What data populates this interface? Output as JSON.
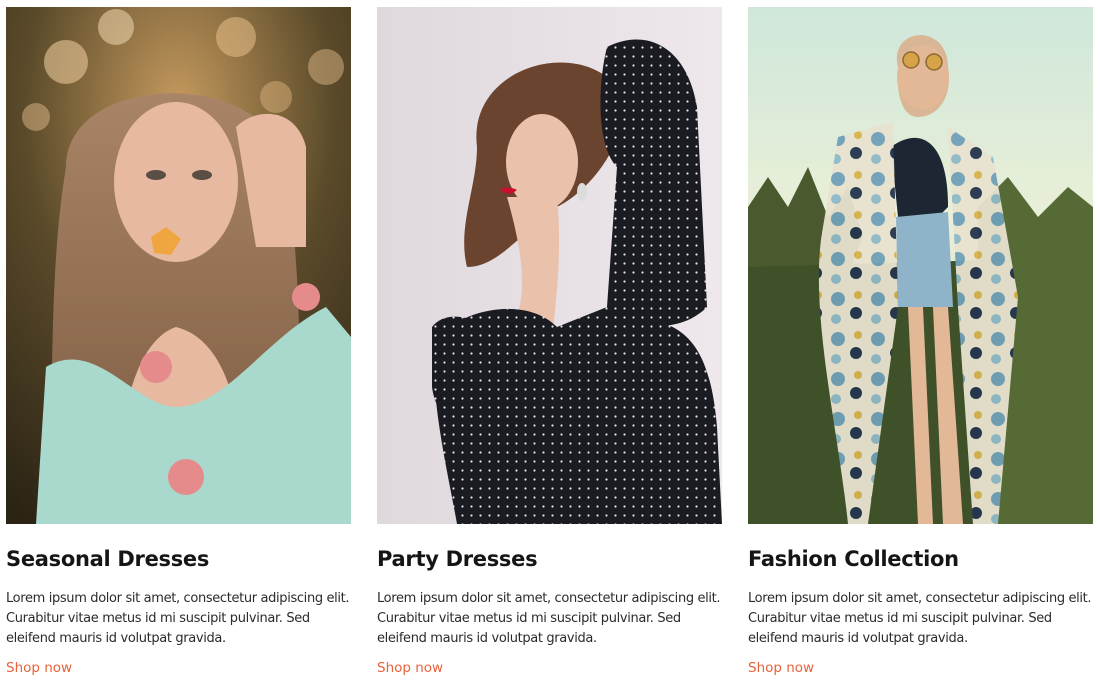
{
  "cards": [
    {
      "title": "Seasonal Dresses",
      "description_lines": [
        "Lorem ipsum dolor sit amet, consectetur adipiscing elit.",
        "Curabitur vitae metus id mi suscipit pulvinar. Sed",
        "eleifend mauris id volutpat gravida."
      ],
      "link": "Shop now",
      "image": "woman-long-hair-flower-photo"
    },
    {
      "title": "Party Dresses",
      "description_lines": [
        "Lorem ipsum dolor sit amet, consectetur adipiscing elit.",
        "Curabitur vitae metus id mi suscipit pulvinar. Sed",
        "eleifend mauris id volutpat gravida."
      ],
      "link": "Shop now",
      "image": "woman-polka-dot-dress-photo"
    },
    {
      "title": "Fashion Collection",
      "description_lines": [
        "Lorem ipsum dolor sit amet, consectetur adipiscing elit.",
        "Curabitur vitae metus id mi suscipit pulvinar. Sed",
        "eleifend mauris id volutpat gravida."
      ],
      "link": "Shop now",
      "image": "woman-floral-kimono-grass-photo"
    }
  ],
  "colors": {
    "link": "#e8623a",
    "title": "#151515",
    "text": "#2b2b2b"
  }
}
